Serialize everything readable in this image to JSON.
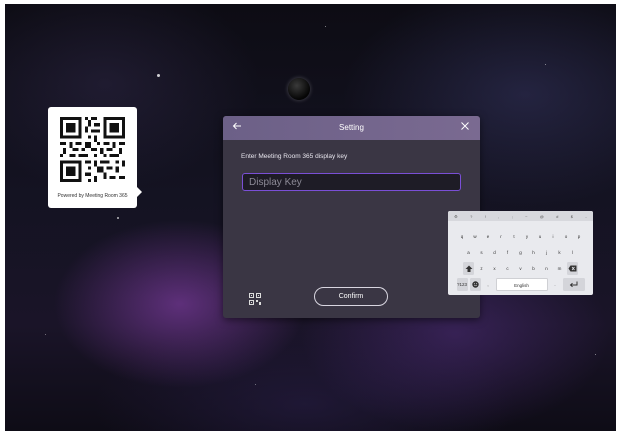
{
  "qr_card": {
    "caption": "Powered by Meeting Room 365"
  },
  "dialog": {
    "title": "Setting",
    "prompt": "Enter Meeting Room 365 display key",
    "input_placeholder": "Display Key",
    "input_value": "",
    "confirm_label": "Confirm"
  },
  "keyboard": {
    "toolbar": [
      "⚙",
      "?",
      "!",
      ",",
      ";",
      "~",
      "@",
      "#",
      "$",
      "-"
    ],
    "row1": [
      "q",
      "w",
      "e",
      "r",
      "t",
      "y",
      "u",
      "i",
      "o",
      "p"
    ],
    "row2": [
      "a",
      "s",
      "d",
      "f",
      "g",
      "h",
      "j",
      "k",
      "l"
    ],
    "row3": [
      "z",
      "x",
      "c",
      "v",
      "b",
      "n",
      "m"
    ],
    "numbers_label": "?123",
    "comma": ",",
    "space_label": "English",
    "period": "."
  }
}
